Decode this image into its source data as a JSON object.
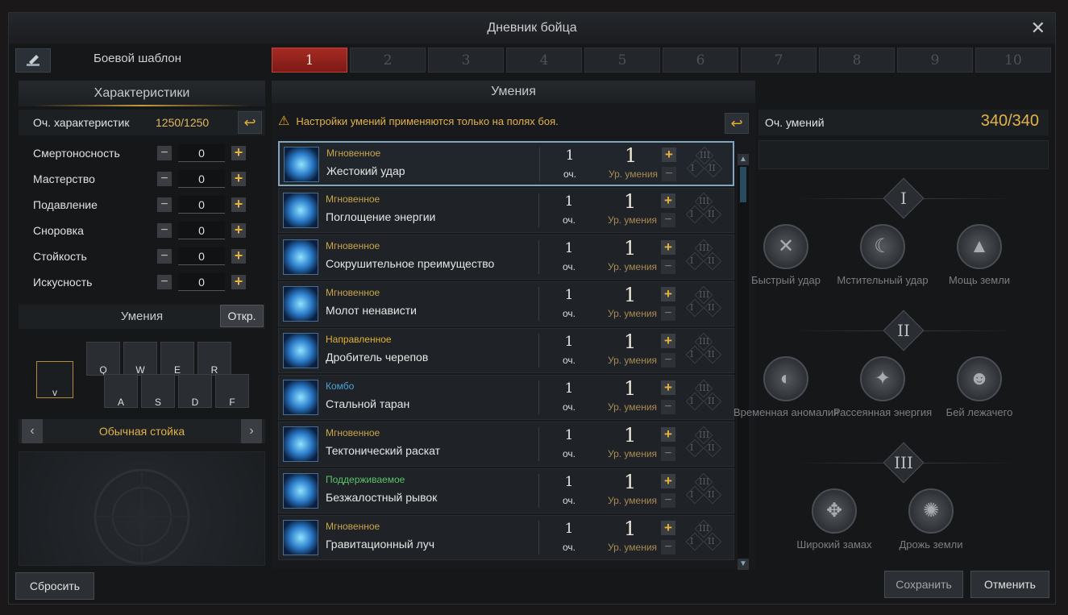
{
  "window": {
    "title": "Дневник бойца",
    "close": "✕"
  },
  "template": {
    "label": "Боевой шаблон",
    "tabs": [
      "1",
      "2",
      "3",
      "4",
      "5",
      "6",
      "7",
      "8",
      "9",
      "10"
    ],
    "active_tab": 0
  },
  "stats": {
    "title": "Характеристики",
    "points_label": "Оч. характеристик",
    "points_value": "1250/1250",
    "items": [
      {
        "name": "Смертоносность",
        "value": "0"
      },
      {
        "name": "Мастерство",
        "value": "0"
      },
      {
        "name": "Подавление",
        "value": "0"
      },
      {
        "name": "Сноровка",
        "value": "0"
      },
      {
        "name": "Стойкость",
        "value": "0"
      },
      {
        "name": "Искусность",
        "value": "0"
      }
    ]
  },
  "skills_panel": {
    "title": "Умения",
    "open_label": "Откр.",
    "keys": [
      "v",
      "Q",
      "W",
      "E",
      "R",
      "A",
      "S",
      "D",
      "F"
    ],
    "stance": "Обычная стойка",
    "prev": "‹",
    "next": "›"
  },
  "skills": {
    "title": "Умения",
    "warning": "Настройки умений применяются только на полях боя.",
    "cost_label": "оч.",
    "level_label": "Ур. умения",
    "tripod_labels": [
      "III",
      "I",
      "II"
    ],
    "list": [
      {
        "type": "Мгновенное",
        "type_color": "#c9a64a",
        "name": "Жестокий удар",
        "cost": "1",
        "level": "1"
      },
      {
        "type": "Мгновенное",
        "type_color": "#c9a64a",
        "name": "Поглощение энергии",
        "cost": "1",
        "level": "1"
      },
      {
        "type": "Мгновенное",
        "type_color": "#c9a64a",
        "name": "Сокрушительное преимущество",
        "cost": "1",
        "level": "1"
      },
      {
        "type": "Мгновенное",
        "type_color": "#c9a64a",
        "name": "Молот ненависти",
        "cost": "1",
        "level": "1"
      },
      {
        "type": "Направленное",
        "type_color": "#e0b22f",
        "name": "Дробитель черепов",
        "cost": "1",
        "level": "1"
      },
      {
        "type": "Комбо",
        "type_color": "#4aa3d8",
        "name": "Стальной таран",
        "cost": "1",
        "level": "1"
      },
      {
        "type": "Мгновенное",
        "type_color": "#c9a64a",
        "name": "Тектонический раскат",
        "cost": "1",
        "level": "1"
      },
      {
        "type": "Поддерживаемое",
        "type_color": "#5ac46a",
        "name": "Безжалостный рывок",
        "cost": "1",
        "level": "1"
      },
      {
        "type": "Мгновенное",
        "type_color": "#c9a64a",
        "name": "Гравитационный луч",
        "cost": "1",
        "level": "1"
      }
    ]
  },
  "tree": {
    "points_label": "Оч. умений",
    "points_value": "340/340",
    "tiers": [
      {
        "label": "I",
        "nodes": [
          "Быстрый удар",
          "Мстительный удар",
          "Мощь земли"
        ]
      },
      {
        "label": "II",
        "nodes": [
          "Временная аномалия",
          "Рассеянная энергия",
          "Бей лежачего"
        ]
      },
      {
        "label": "III",
        "nodes": [
          "Широкий замах",
          "Дрожь земли"
        ]
      }
    ]
  },
  "buttons": {
    "reset": "Сбросить",
    "save": "Сохранить",
    "cancel": "Отменить"
  }
}
